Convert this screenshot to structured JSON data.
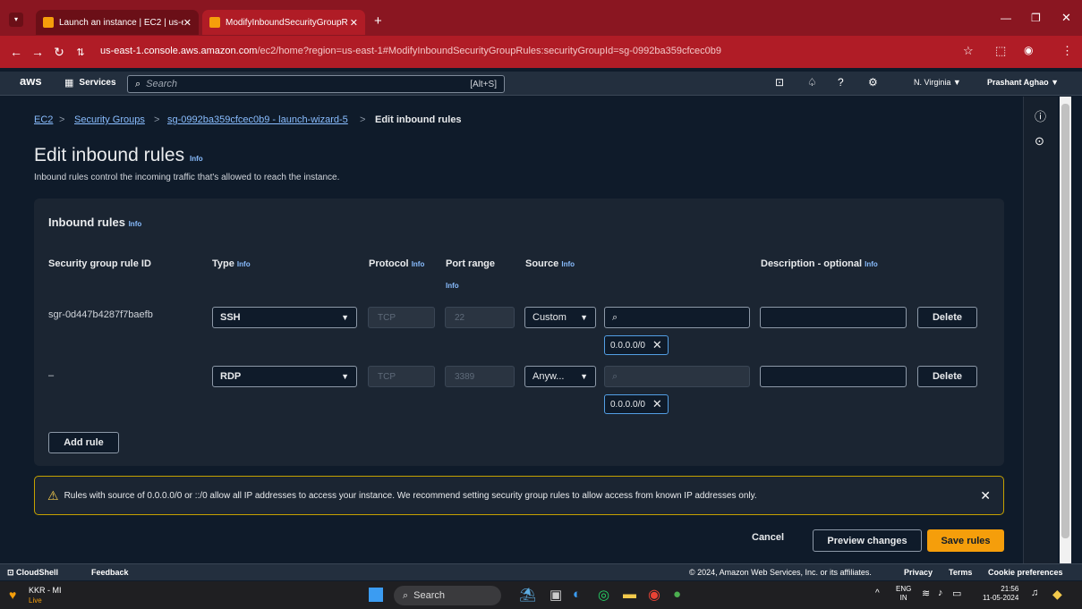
{
  "browser": {
    "tabs": [
      {
        "title": "Launch an instance | EC2 | us-ea",
        "close": "✕"
      },
      {
        "title": "ModifyInboundSecurityGroupR",
        "close": "✕"
      }
    ],
    "new_tab": "+",
    "url_host": "us-east-1.console.aws.amazon.com",
    "url_path": "/ec2/home?region=us-east-1#ModifyInboundSecurityGroupRules:securityGroupId=sg-0992ba359cfcec0b9"
  },
  "aws_header": {
    "logo": "aws",
    "services": "Services",
    "search_placeholder": "Search",
    "search_shortcut": "[Alt+S]",
    "region": "N. Virginia ▼",
    "user": "Prashant Aghao ▼"
  },
  "breadcrumb": {
    "items": [
      "EC2",
      "Security Groups",
      "sg-0992ba359cfcec0b9 - launch-wizard-5"
    ],
    "current": "Edit inbound rules",
    "separator": ">"
  },
  "page": {
    "title": "Edit inbound rules",
    "info": "Info",
    "subtitle": "Inbound rules control the incoming traffic that's allowed to reach the instance."
  },
  "panel": {
    "title": "Inbound rules",
    "info": "Info",
    "columns": {
      "rule_id": "Security group rule ID",
      "type": "Type",
      "protocol": "Protocol",
      "port": "Port range",
      "source": "Source",
      "description": "Description - optional",
      "info": "Info"
    },
    "rows": [
      {
        "rule_id": "sgr-0d447b4287f7baefb",
        "type": "SSH",
        "protocol": "TCP",
        "port": "22",
        "source": "Custom",
        "cidr": "0.0.0.0/0",
        "delete": "Delete"
      },
      {
        "rule_id": "–",
        "type": "RDP",
        "protocol": "TCP",
        "port": "3389",
        "source": "Anyw...",
        "cidr": "0.0.0.0/0",
        "delete": "Delete"
      }
    ],
    "add_rule": "Add rule"
  },
  "warning": {
    "text": "Rules with source of 0.0.0.0/0 or ::/0 allow all IP addresses to access your instance. We recommend setting security group rules to allow access from known IP addresses only."
  },
  "actions": {
    "cancel": "Cancel",
    "preview": "Preview changes",
    "save": "Save rules"
  },
  "footer": {
    "cloudshell": "CloudShell",
    "feedback": "Feedback",
    "copyright": "© 2024, Amazon Web Services, Inc. or its affiliates.",
    "privacy": "Privacy",
    "terms": "Terms",
    "cookies": "Cookie preferences"
  },
  "taskbar": {
    "widget_title": "KKR - MI",
    "widget_sub": "Live",
    "search": "Search",
    "lang": "ENG",
    "lang_sub": "IN",
    "time": "21:56",
    "date": "11-05-2024"
  },
  "colors": {
    "accent_link": "#89bdff",
    "primary_button": "#f59e0b",
    "browser_frame": "#b01c26",
    "warning_border": "#c5a100"
  }
}
